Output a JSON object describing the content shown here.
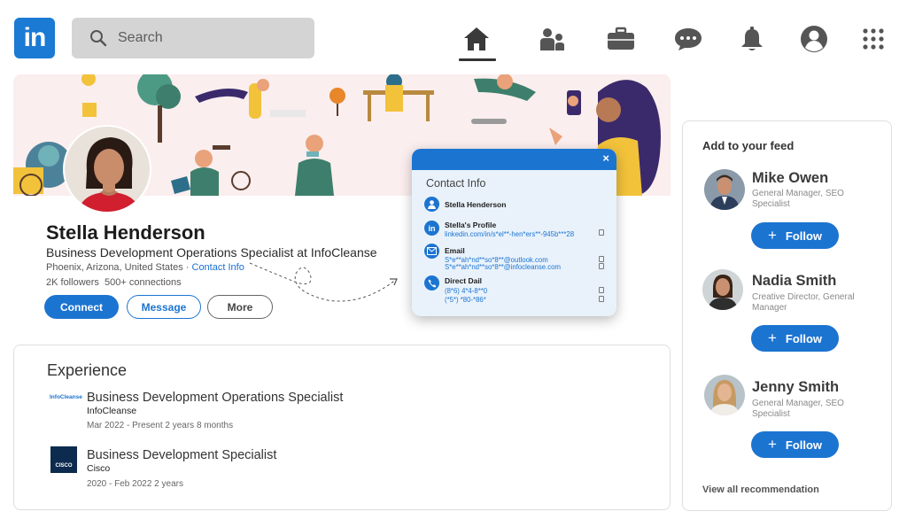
{
  "nav": {
    "logo_text": "in",
    "search_placeholder": "Search",
    "icons": [
      "home-icon",
      "people-icon",
      "briefcase-icon",
      "messages-icon",
      "bell-icon",
      "profile-icon",
      "grid-icon"
    ]
  },
  "profile": {
    "name": "Stella Henderson",
    "headline": "Business Development Operations Specialist at InfoCleanse",
    "location": "Phoenix, Arizona, United States",
    "location_sep": " · ",
    "contact_link": "Contact Info",
    "followers": "2K followers",
    "connections": "500+ connections",
    "buttons": {
      "connect": "Connect",
      "message": "Message",
      "more": "More"
    }
  },
  "contact_info": {
    "title": "Contact Info",
    "close": "×",
    "name": "Stella Henderson",
    "profile_label": "Stella's Profile",
    "profile_url": "linkedin.com/in/s*el**-hen*ers**-945b***28",
    "email_label": "Email",
    "emails": [
      "S*e**ah*nd**so*8**@outlook.com",
      "S*e**ah*nd**so*8**@infocleanse.com"
    ],
    "phone_label": "Direct Dail",
    "phones": [
      "(8*6) 4*4-8**0",
      "(*5*) *80-*86*"
    ]
  },
  "experience": {
    "title": "Experience",
    "items": [
      {
        "logo": "InfoCleanse",
        "role": "Business Development Operations Specialist",
        "company": "InfoCleanse",
        "dates": "Mar 2022 - Present 2 years 8 months"
      },
      {
        "logo": "CISCO",
        "role": "Business Development Specialist",
        "company": "Cisco",
        "dates": "2020 - Feb 2022 2 years"
      }
    ]
  },
  "feed": {
    "title": "Add to your feed",
    "follow_label": "Follow",
    "people": [
      {
        "name": "Mike Owen",
        "sub": "General Manager, SEO Specialist"
      },
      {
        "name": "Nadia Smith",
        "sub": "Creative Director, General Manager"
      },
      {
        "name": "Jenny Smith",
        "sub": "General Manager, SEO Specialist"
      }
    ],
    "view_all": "View all recommendation"
  },
  "colors": {
    "brand": "#1c74d1",
    "banner": "#fbeeee",
    "popup_bg": "#e9f2fb"
  }
}
